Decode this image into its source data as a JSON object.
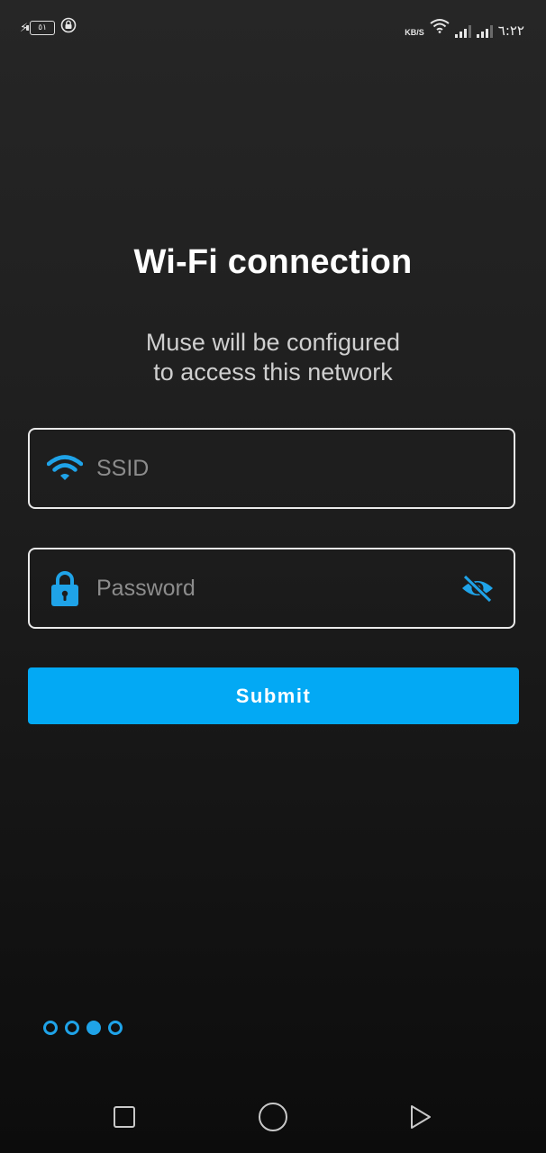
{
  "status_bar": {
    "battery_level": "٥١",
    "net_speed": "KB/S",
    "time": "٦:٢٢"
  },
  "page": {
    "title": "Wi-Fi connection",
    "subtitle_line1": "Muse will be configured",
    "subtitle_line2": "to access this network"
  },
  "form": {
    "ssid": {
      "placeholder": "SSID",
      "value": "",
      "icon": "wifi-icon"
    },
    "password": {
      "placeholder": "Password",
      "value": "",
      "icon": "lock-icon",
      "toggle_icon": "eye-off-icon"
    },
    "submit_label": "Submit"
  },
  "pager": {
    "total": 4,
    "active_index": 2
  },
  "colors": {
    "accent": "#03a9f4",
    "background_top": "#262626",
    "background_bottom": "#0c0c0c",
    "field_border": "#e9e9e9"
  },
  "navbar": {
    "buttons": [
      "recent-apps-icon",
      "home-icon",
      "back-icon"
    ]
  }
}
